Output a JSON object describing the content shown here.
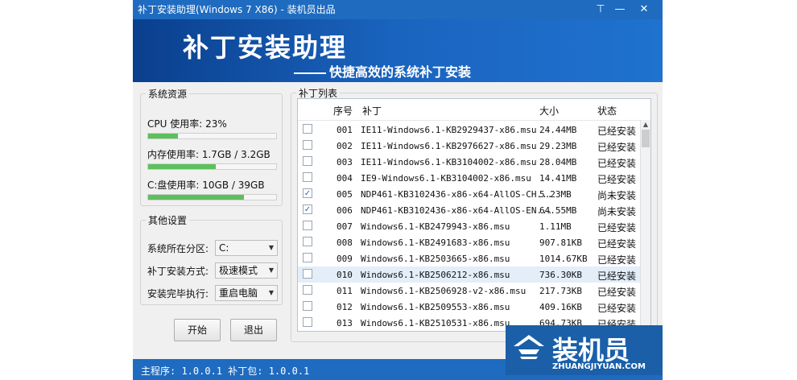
{
  "window": {
    "title": "补丁安装助理(Windows 7 X86) - 装机员出品",
    "minimize_glyph": "⊤",
    "close_glyph": "✕"
  },
  "banner": {
    "title": "补丁安装助理",
    "subtitle": "快捷高效的系统补丁安装"
  },
  "resources": {
    "legend": "系统资源",
    "cpu_label": "CPU 使用率: 23%",
    "cpu_usage": 0.23,
    "mem_label": "内存使用率: 1.7GB / 3.2GB",
    "mem_usage": 0.53,
    "disk_label": "C:盘使用率: 10GB / 39GB",
    "disk_usage": 0.75
  },
  "settings": {
    "legend": "其他设置",
    "partition_label": "系统所在分区:",
    "partition_value": "C:",
    "mode_label": "补丁安装方式:",
    "mode_value": "极速模式",
    "after_label": "安装完毕执行:",
    "after_value": "重启电脑"
  },
  "buttons": {
    "start": "开始",
    "exit": "退出"
  },
  "patch_list": {
    "legend": "补丁列表",
    "columns": {
      "num": "序号",
      "name": "补丁",
      "size": "大小",
      "status": "状态"
    },
    "rows": [
      {
        "checked": false,
        "num": "001",
        "name": "IE11-Windows6.1-KB2929437-x86.msu",
        "size": "24.44MB",
        "status": "已经安装"
      },
      {
        "checked": false,
        "num": "002",
        "name": "IE11-Windows6.1-KB2976627-x86.msu",
        "size": "29.23MB",
        "status": "已经安装"
      },
      {
        "checked": false,
        "num": "003",
        "name": "IE11-Windows6.1-KB3104002-x86.msu",
        "size": "28.04MB",
        "status": "已经安装"
      },
      {
        "checked": false,
        "num": "004",
        "name": "IE9-Windows6.1-KB3104002-x86.msu",
        "size": "14.41MB",
        "status": "已经安装"
      },
      {
        "checked": true,
        "num": "005",
        "name": "NDP461-KB3102436-x86-x64-AllOS-CH...",
        "size": "5.23MB",
        "status": "尚未安装"
      },
      {
        "checked": true,
        "num": "006",
        "name": "NDP461-KB3102436-x86-x64-AllOS-EN...",
        "size": "64.55MB",
        "status": "尚未安装"
      },
      {
        "checked": false,
        "num": "007",
        "name": "Windows6.1-KB2479943-x86.msu",
        "size": "1.11MB",
        "status": "已经安装"
      },
      {
        "checked": false,
        "num": "008",
        "name": "Windows6.1-KB2491683-x86.msu",
        "size": "907.81KB",
        "status": "已经安装"
      },
      {
        "checked": false,
        "num": "009",
        "name": "Windows6.1-KB2503665-x86.msu",
        "size": "1014.67KB",
        "status": "已经安装"
      },
      {
        "checked": false,
        "num": "010",
        "name": "Windows6.1-KB2506212-x86.msu",
        "size": "736.30KB",
        "status": "已经安装",
        "selected": true
      },
      {
        "checked": false,
        "num": "011",
        "name": "Windows6.1-KB2506928-v2-x86.msu",
        "size": "217.73KB",
        "status": "已经安装"
      },
      {
        "checked": false,
        "num": "012",
        "name": "Windows6.1-KB2509553-x86.msu",
        "size": "409.16KB",
        "status": "已经安装"
      },
      {
        "checked": false,
        "num": "013",
        "name": "Windows6.1-KB2510531-x86.msu",
        "size": "694.73KB",
        "status": "已经安装"
      }
    ]
  },
  "statusbar": {
    "text": "主程序: 1.0.0.1 补丁包: 1.0.0.1"
  },
  "watermark": {
    "brand": "装机员",
    "url": "ZHUANGJIYUAN.COM"
  },
  "colors": {
    "accent": "#1e6bc0",
    "progress": "#5cc05c",
    "selected_row": "#e3eef9"
  }
}
